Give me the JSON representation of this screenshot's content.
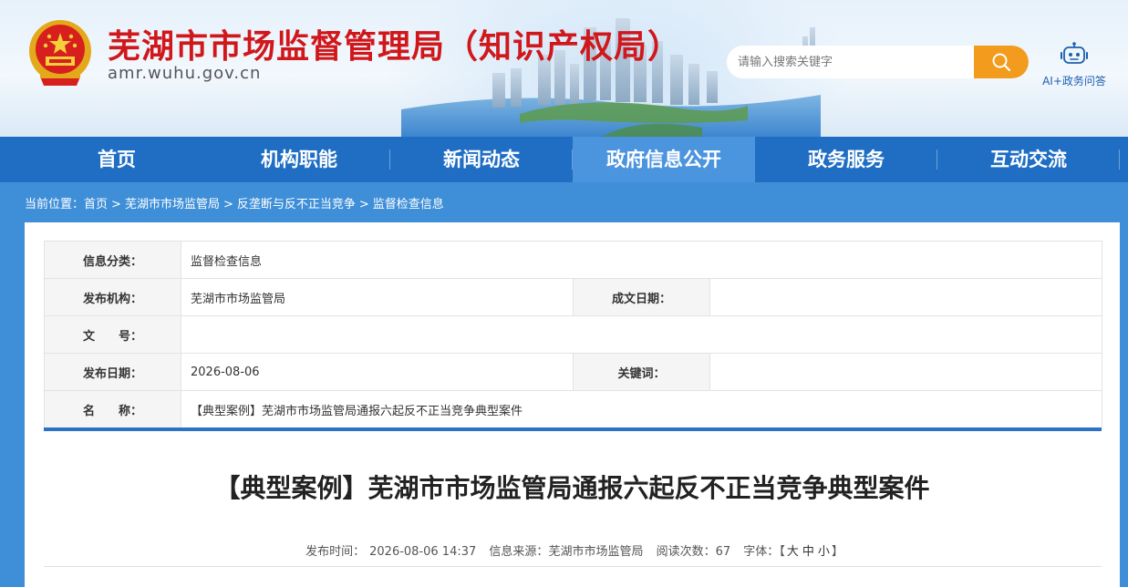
{
  "header": {
    "site_title": "芜湖市市场监督管理局（知识产权局）",
    "site_domain": "amr.wuhu.gov.cn",
    "search_placeholder": "请输入搜索关键字",
    "ai_label": "AI+政务问答",
    "emblem_icon": "national-emblem-icon",
    "search_icon": "search-icon",
    "ai_icon": "robot-icon"
  },
  "nav": {
    "items": [
      {
        "label": "首页"
      },
      {
        "label": "机构职能"
      },
      {
        "label": "新闻动态"
      },
      {
        "label": "政府信息公开"
      },
      {
        "label": "政务服务"
      },
      {
        "label": "互动交流"
      }
    ],
    "active_index": 3
  },
  "breadcrumb": {
    "prefix": "当前位置：",
    "items": [
      "首页",
      "芜湖市市场监管局",
      "反垄断与反不正当竞争",
      "监督检查信息"
    ],
    "separator": ">"
  },
  "info": {
    "category_label": "信息分类：",
    "category_value": "监督检查信息",
    "publisher_label": "发布机构：",
    "publisher_value": "芜湖市市场监管局",
    "created_label": "成文日期：",
    "created_value": "",
    "docno_label": "文　　号：",
    "docno_value": "",
    "pubdate_label": "发布日期：",
    "pubdate_value": "2026-08-06",
    "keywords_label": "关键词：",
    "keywords_value": "",
    "name_label": "名　　称：",
    "name_value": "【典型案例】芜湖市市场监管局通报六起反不正当竞争典型案件"
  },
  "article": {
    "title": "【典型案例】芜湖市市场监管局通报六起反不正当竞争典型案件",
    "meta": {
      "time_label": "发布时间：",
      "time_value": "2026-08-06 14:37",
      "source_label": "信息来源：",
      "source_value": "芜湖市市场监管局",
      "views_label": "阅读次数：",
      "views_value": "67",
      "fontsize_label": "字体：",
      "fontsize_open": "【",
      "fontsize_large": "大",
      "fontsize_medium": "中",
      "fontsize_small": "小",
      "fontsize_close": "】"
    }
  },
  "colors": {
    "title_red": "#d0171b",
    "nav_blue": "#1f6ec4",
    "nav_active": "#4b94de",
    "page_bg": "#3f8fd8",
    "search_orange": "#f29b1d"
  }
}
